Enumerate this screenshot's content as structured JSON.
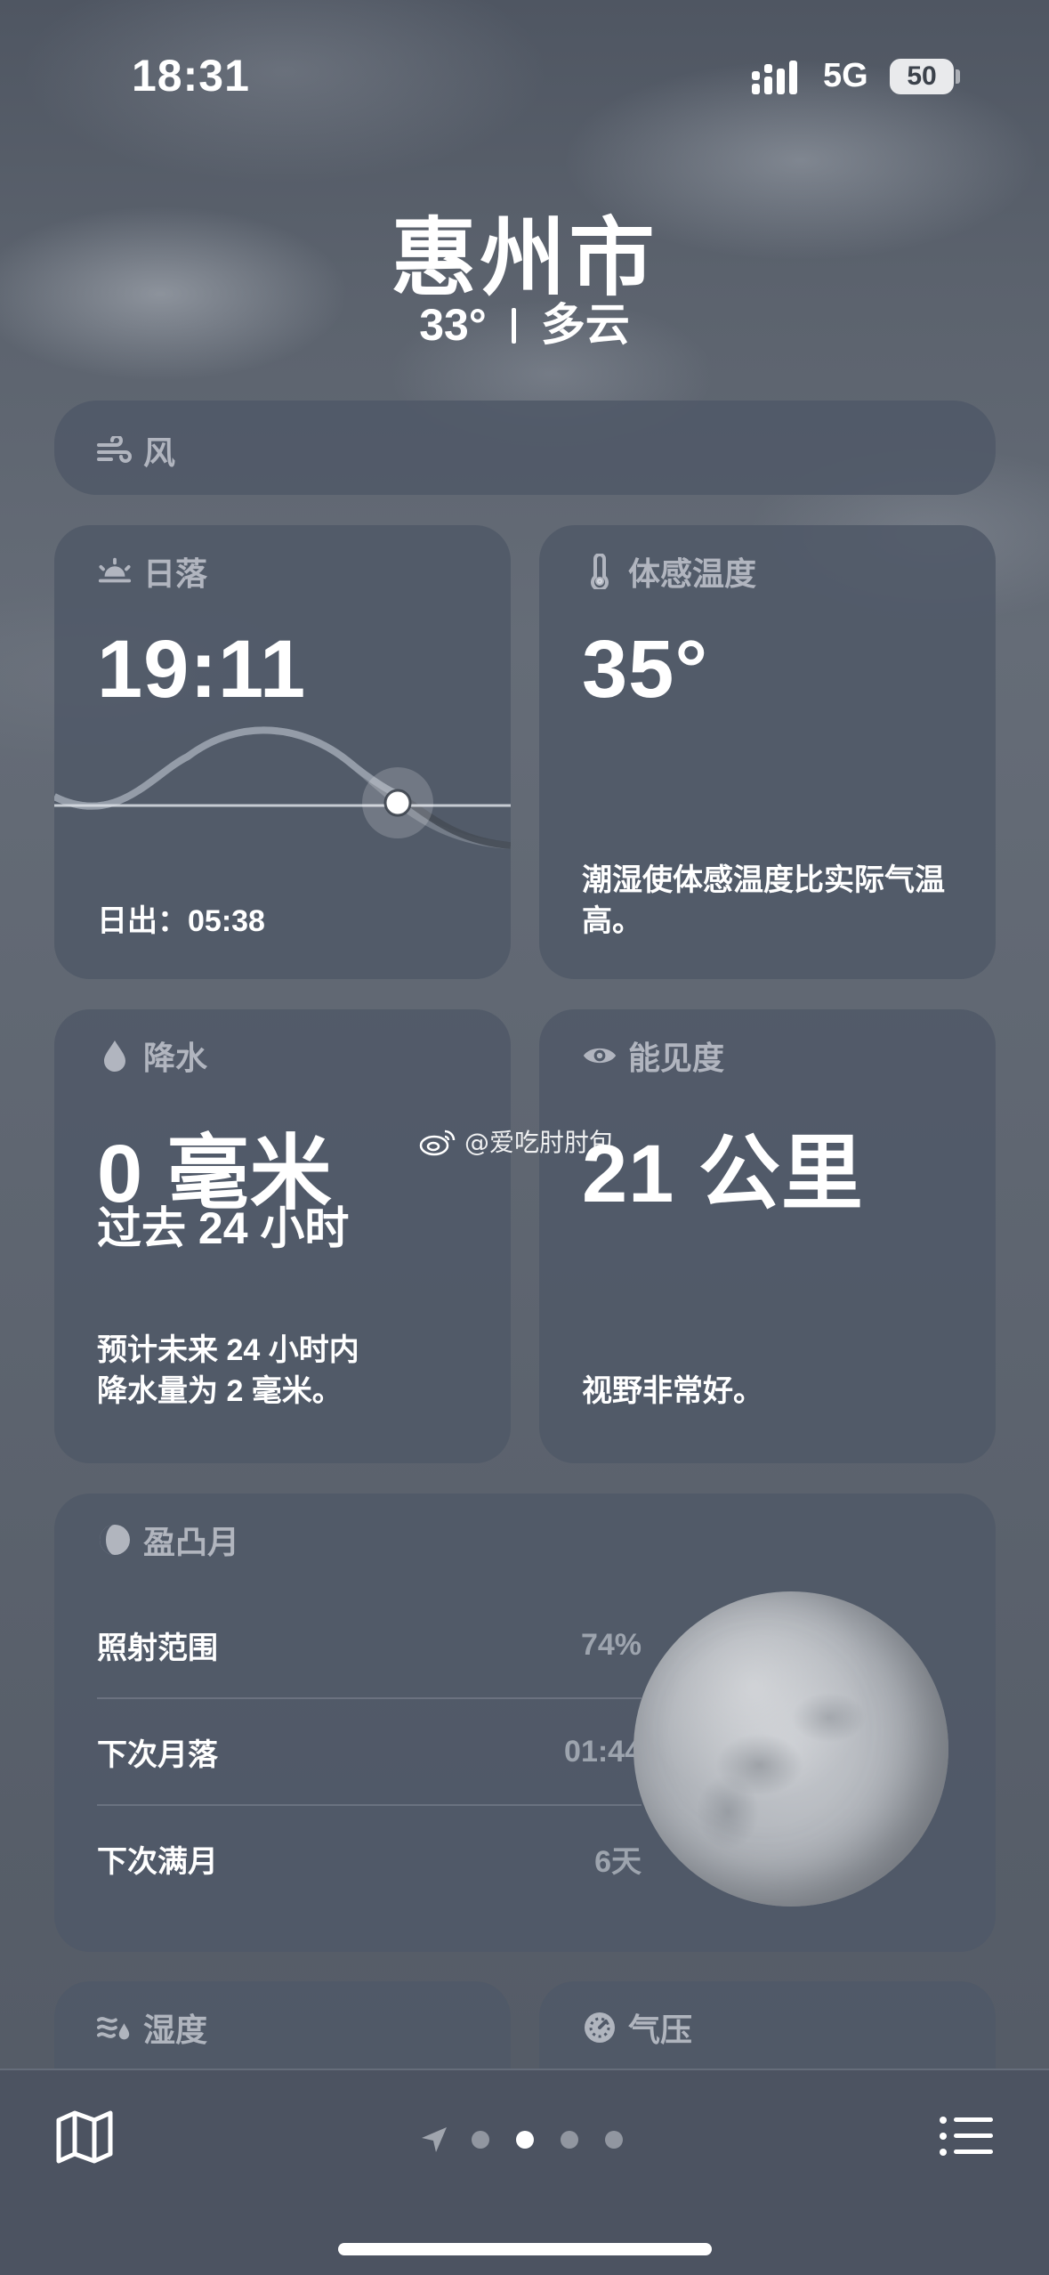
{
  "status_bar": {
    "time": "18:31",
    "network": "5G",
    "battery": "50"
  },
  "header": {
    "city": "惠州市",
    "temperature": "33°",
    "condition": "多云"
  },
  "wind": {
    "title": "风"
  },
  "sunset": {
    "title": "日落",
    "time": "19:11",
    "sunrise": "日出：05:38"
  },
  "feels_like": {
    "title": "体感温度",
    "value": "35°",
    "description": "潮湿使体感温度比实际气温高。"
  },
  "precipitation": {
    "title": "降水",
    "value": "0 毫米",
    "period": "过去 24 小时",
    "forecast_line1": "预计未来 24 小时内",
    "forecast_line2": "降水量为 2 毫米。"
  },
  "visibility": {
    "title": "能见度",
    "value": "21 公里",
    "description": "视野非常好。"
  },
  "moon": {
    "title": "盈凸月",
    "rows": [
      {
        "label": "照射范围",
        "value": "74%"
      },
      {
        "label": "下次月落",
        "value": "01:44"
      },
      {
        "label": "下次满月",
        "value": "6天"
      }
    ]
  },
  "humidity": {
    "title": "湿度"
  },
  "pressure": {
    "title": "气压"
  },
  "watermark": "@爱吃肘肘包",
  "icons": {
    "wind": "wind-icon",
    "sunset": "sunset-icon",
    "feels": "thermometer-icon",
    "precip": "drop-icon",
    "vis": "eye-icon",
    "moon": "moon-phase-icon",
    "humidity": "humidity-icon",
    "pressure": "gauge-icon",
    "map": "map-icon",
    "list": "list-icon",
    "location": "location-arrow-icon"
  }
}
